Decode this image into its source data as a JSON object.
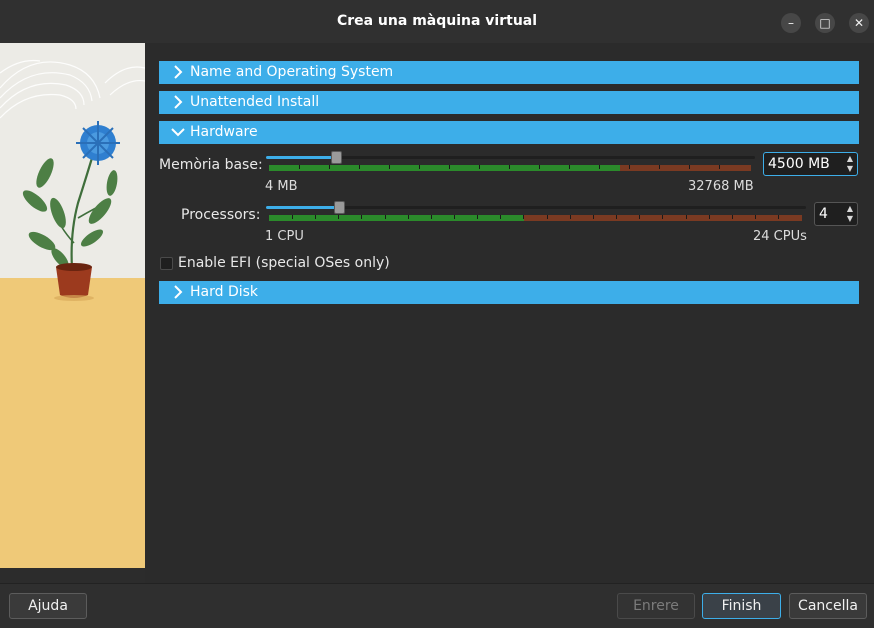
{
  "window": {
    "title": "Crea una màquina virtual",
    "controls": {
      "minimize": "–",
      "maximize": "□",
      "close": "✕"
    }
  },
  "sections": {
    "name_os": {
      "label": "Name and Operating System",
      "expanded": false
    },
    "unattended": {
      "label": "Unattended Install",
      "expanded": false
    },
    "hardware": {
      "label": "Hardware",
      "expanded": true
    },
    "hard_disk": {
      "label": "Hard Disk",
      "expanded": false
    }
  },
  "hardware": {
    "memory": {
      "label": "Memòria base:",
      "min_label": "4 MB",
      "max_label": "32768 MB",
      "value": "4500",
      "unit": "MB",
      "min": 4,
      "max": 32768
    },
    "processors": {
      "label": "Processors:",
      "min_label": "1 CPU",
      "max_label": "24 CPUs",
      "value": "4",
      "min": 1,
      "max": 24
    },
    "efi": {
      "label": "Enable EFI (special OSes only)",
      "checked": false
    }
  },
  "buttons": {
    "help": "Ajuda",
    "back": "Enrere",
    "finish": "Finish",
    "cancel": "Cancella"
  },
  "colors": {
    "accent": "#3daee9",
    "scale_ok": "#2b8a2b",
    "scale_warn": "#7a3a22"
  },
  "icons": {
    "collapsed": "chevron-right-icon",
    "expanded": "chevron-down-icon"
  }
}
